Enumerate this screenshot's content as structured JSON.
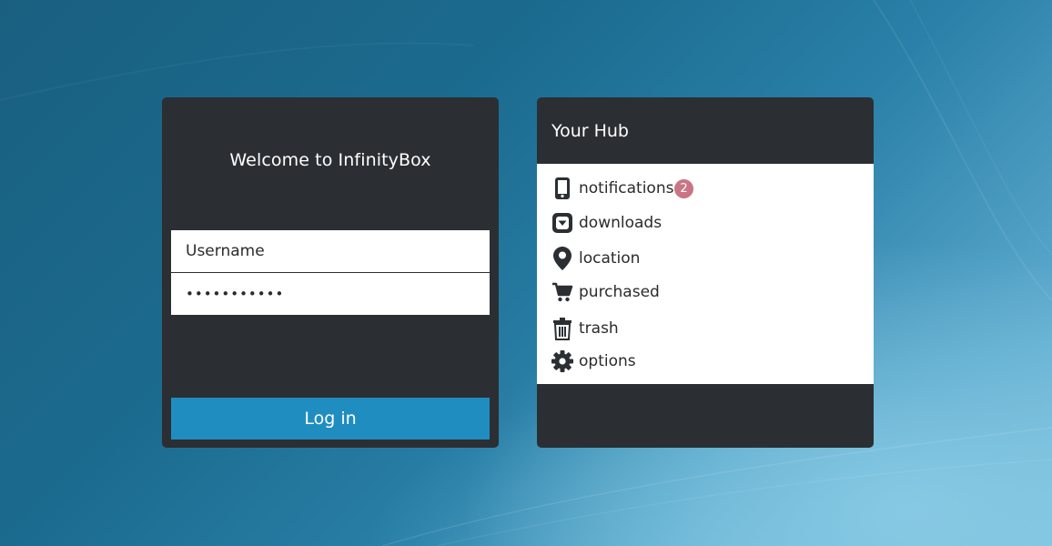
{
  "login": {
    "welcome": "Welcome to InfinityBox",
    "username_placeholder": "Username",
    "password_value": "secretpass1",
    "login_label": "Log in"
  },
  "hub": {
    "title": "Your Hub",
    "items": [
      {
        "label": "notifications",
        "icon": "phone-icon",
        "badge": "2"
      },
      {
        "label": "downloads",
        "icon": "download-box-icon"
      },
      {
        "label": "location",
        "icon": "map-pin-icon"
      },
      {
        "label": "purchased",
        "icon": "shopping-cart-icon"
      },
      {
        "label": "trash",
        "icon": "trash-icon"
      },
      {
        "label": "options",
        "icon": "gear-icon"
      }
    ]
  },
  "colors": {
    "panel": "#2b2f33",
    "accent": "#1f8dc0",
    "badge": "#c97583"
  }
}
